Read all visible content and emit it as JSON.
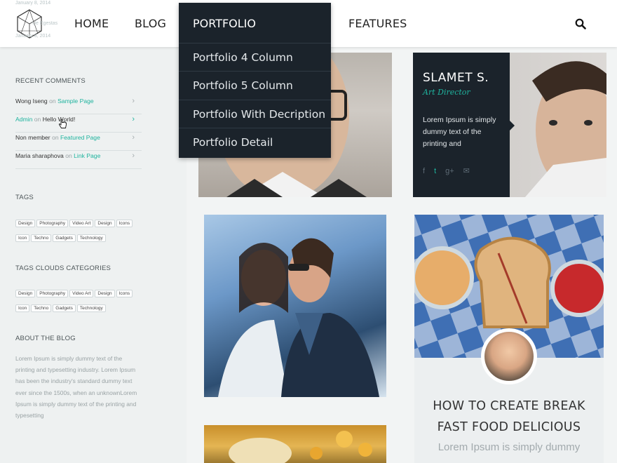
{
  "header": {
    "nav": [
      {
        "label": "HOME"
      },
      {
        "label": "BLOG"
      },
      {
        "label": "PORTFOLIO"
      },
      {
        "label": "FEATURES"
      }
    ],
    "ghost": {
      "date_1": "January 8, 2014",
      "text_1": "Ue Egestas",
      "date_2": "January 8, 2014"
    }
  },
  "dropdown": {
    "title": "PORTFOLIO",
    "items": [
      {
        "label": "Portfolio 4 Column"
      },
      {
        "label": "Portfolio 5 Column"
      },
      {
        "label": "Portfolio With Decription"
      },
      {
        "label": "Portfolio Detail"
      }
    ]
  },
  "sidebar": {
    "recent_comments": {
      "heading": "RECENT COMMENTS",
      "items": [
        {
          "author": "Wong Iseng",
          "on": "on",
          "target": "Sample Page",
          "author_link": false
        },
        {
          "author": "Admin",
          "on": "on",
          "target": "Hello World!",
          "author_link": true
        },
        {
          "author": "Non member",
          "on": "on",
          "target": "Featured Page",
          "author_link": false
        },
        {
          "author": "Maria sharaphova",
          "on": "on",
          "target": "Link Page",
          "author_link": false
        }
      ]
    },
    "tags": {
      "heading": "TAGS",
      "items": [
        "Design",
        "Photography",
        "Video Art",
        "Design",
        "Icons",
        "Icon",
        "Techno",
        "Gadgets",
        "Technology"
      ]
    },
    "tag_clouds": {
      "heading": "TAGS CLOUDS CATEGORIES",
      "items": [
        "Design",
        "Photography",
        "Video Art",
        "Design",
        "Icons",
        "Icon",
        "Techno",
        "Gadgets",
        "Technology"
      ]
    },
    "about": {
      "heading": "ABOUT THE BLOG",
      "text": "Lorem Ipsum is simply dummy text of the printing and typesetting industry. Lorem Ipsum has been the industry's standard dummy text ever since the 1500s, when an unknownLorem Ipsum is simply dummy text of the printing and typesetting"
    }
  },
  "team": {
    "name": "SLAMET S.",
    "role": "Art Director",
    "desc": "Lorem Ipsum is simply dummy text of the printing and",
    "social": [
      "f",
      "t",
      "g+",
      "✉"
    ]
  },
  "blog_post": {
    "title_line_1": "HOW TO CREATE BREAK",
    "title_line_2": "FAST FOOD DELICIOUS",
    "excerpt": "Lorem Ipsum is simply dummy"
  },
  "colors": {
    "accent": "#1fb39e",
    "dark_panel": "#1b232b",
    "sidebar_bg": "#eef1f1"
  }
}
